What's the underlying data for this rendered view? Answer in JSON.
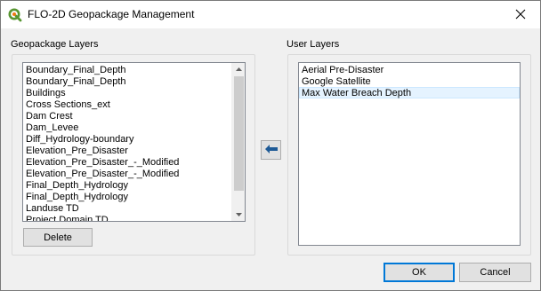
{
  "window": {
    "title": "FLO-2D Geopackage Management"
  },
  "geopackage": {
    "label": "Geopackage Layers",
    "items": [
      "Boundary_Final_Depth",
      "Boundary_Final_Depth",
      "Buildings",
      "Cross Sections_ext",
      "Dam Crest",
      "Dam_Levee",
      "Diff_Hydrology-boundary",
      "Elevation_Pre_Disaster",
      "Elevation_Pre_Disaster_-_Modified",
      "Elevation_Pre_Disaster_-_Modified",
      "Final_Depth_Hydrology",
      "Final_Depth_Hydrology",
      "Landuse TD",
      "Project Domain TD"
    ],
    "delete_label": "Delete"
  },
  "user_layers": {
    "label": "User Layers",
    "items": [
      "Aerial Pre-Disaster",
      "Google Satellite",
      "Max Water Breach Depth"
    ],
    "selected": "Max Water Breach Depth"
  },
  "buttons": {
    "ok": "OK",
    "cancel": "Cancel"
  },
  "icons": {
    "app": "qgis-icon",
    "close": "close-icon",
    "move_left": "arrow-left-icon",
    "scroll_up": "scroll-up-icon",
    "scroll_down": "scroll-down-icon"
  }
}
